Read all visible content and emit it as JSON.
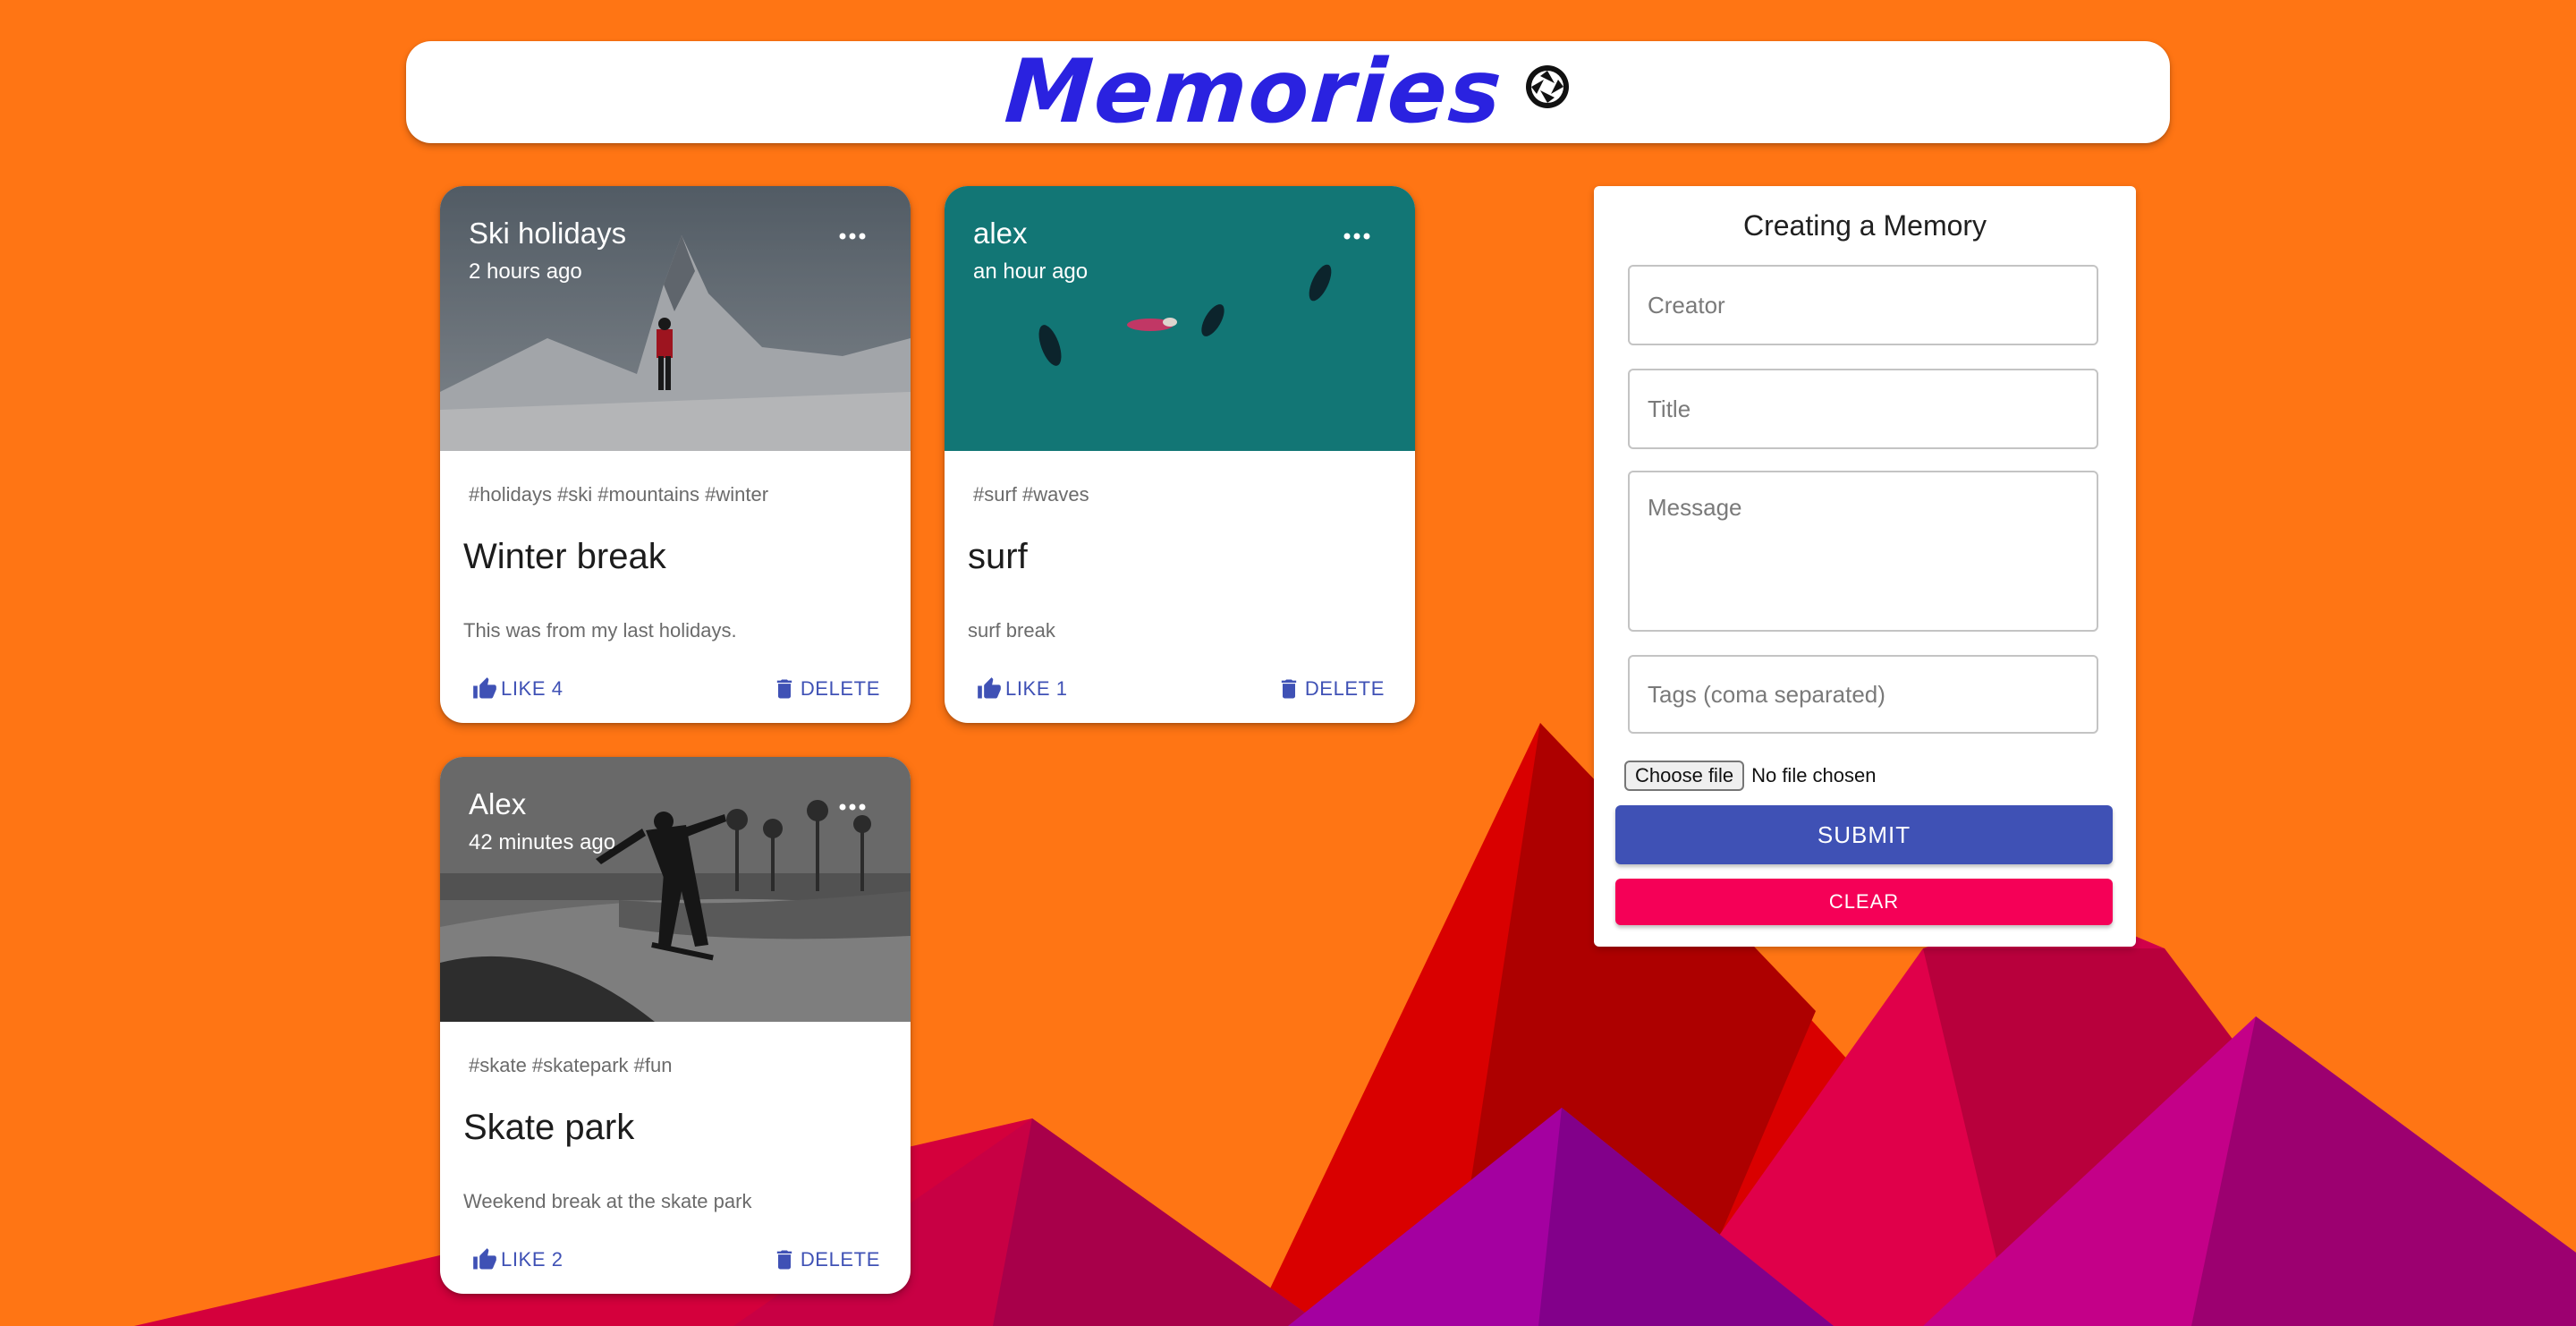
{
  "colors": {
    "background": "#ff7514",
    "brand": "#2a22e0",
    "primary": "#3f51b5",
    "secondary": "#f50057",
    "mountain_red": "#d90000",
    "mountain_crimson": "#c2004a",
    "mountain_magenta": "#a800a8"
  },
  "header": {
    "title": "Memories",
    "logo_icon": "camera-aperture-icon"
  },
  "posts": [
    {
      "author": "Ski holidays",
      "time": "2 hours ago",
      "image": "snowy mountain with hiker",
      "tags": "#holidays #ski #mountains #winter",
      "title": "Winter break",
      "message": "This was from my last holidays.",
      "like_label": "LIKE 4",
      "delete_label": "DELETE"
    },
    {
      "author": "alex",
      "time": "an hour ago",
      "image": "aerial view of surfers in teal water",
      "tags": "#surf #waves",
      "title": "surf",
      "message": "surf break",
      "like_label": "LIKE 1",
      "delete_label": "DELETE"
    },
    {
      "author": "Alex",
      "time": "42 minutes ago",
      "image": "skateboarder in skate park, black and white",
      "tags": "#skate #skatepark #fun",
      "title": "Skate park",
      "message": "Weekend break at the skate park",
      "like_label": "LIKE 2",
      "delete_label": "DELETE"
    }
  ],
  "form": {
    "title": "Creating a Memory",
    "creator_placeholder": "Creator",
    "title_placeholder": "Title",
    "message_placeholder": "Message",
    "tags_placeholder": "Tags (coma separated)",
    "file_button": "Choose file",
    "file_status": "No file chosen",
    "submit_label": "SUBMIT",
    "clear_label": "CLEAR"
  }
}
